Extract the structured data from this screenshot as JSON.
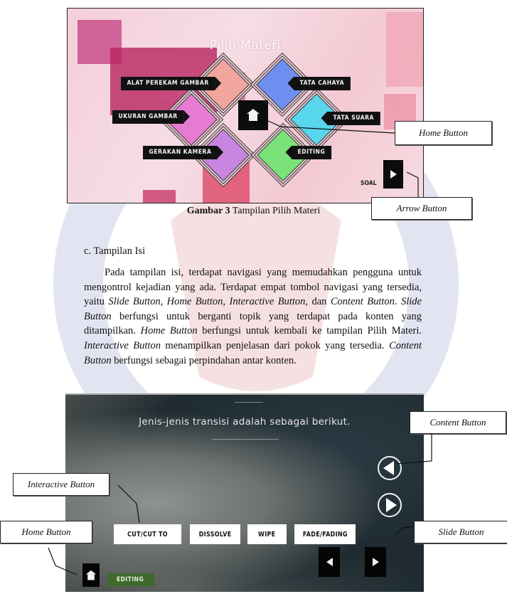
{
  "figure1": {
    "screen_title": "Pilih Materi",
    "topics": [
      {
        "label": "ALAT PEREKAM GAMBAR",
        "color": "#f2a59c",
        "side": "left"
      },
      {
        "label": "UKURAN GAMBAR",
        "color": "#e77ad2",
        "side": "left"
      },
      {
        "label": "GERAKAN KAMERA",
        "color": "#c785e0",
        "side": "left"
      },
      {
        "label": "TATA CAHAYA",
        "color": "#6f8ff0",
        "side": "right"
      },
      {
        "label": "TATA SUARA",
        "color": "#57d6ec",
        "side": "right"
      },
      {
        "label": "EDITING",
        "color": "#7be27a",
        "side": "right"
      }
    ],
    "home_icon": "house-icon",
    "soal_label": "SOAL",
    "arrow_icon": "play-right-icon",
    "callouts": {
      "home_button": "Home Button",
      "arrow_button": "Arrow Button"
    },
    "caption_bold": "Gambar 3",
    "caption_text": " Tampilan Pilih Materi"
  },
  "section": {
    "heading": "c. Tampilan Isi",
    "paragraph": [
      {
        "t": "Pada tampilan isi, terdapat navigasi yang memudahkan pengguna untuk mengontrol kejadian yang ada. Terdapat empat tombol navigasi yang tersedia, yaitu ",
        "i": false
      },
      {
        "t": "Slide Button",
        "i": true
      },
      {
        "t": ", ",
        "i": false
      },
      {
        "t": "Home Button",
        "i": true
      },
      {
        "t": ", ",
        "i": false
      },
      {
        "t": "Interactive Button",
        "i": true
      },
      {
        "t": ", dan ",
        "i": false
      },
      {
        "t": "Content Button",
        "i": true
      },
      {
        "t": ". ",
        "i": false
      },
      {
        "t": "Slide Button",
        "i": true
      },
      {
        "t": " berfungsi untuk berganti topik yang terdapat pada konten yang ditampilkan. ",
        "i": false
      },
      {
        "t": "Home Button",
        "i": true
      },
      {
        "t": " berfungsi untuk kembali ke tampilan Pilih Materi. ",
        "i": false
      },
      {
        "t": "Interactive Button",
        "i": true
      },
      {
        "t": " menampilkan penjelasan dari pokok yang tersedia. ",
        "i": false
      },
      {
        "t": "Content Button",
        "i": true
      },
      {
        "t": " berfungsi sebagai perpindahan antar konten.",
        "i": false
      }
    ]
  },
  "figure2": {
    "screen_title": "Jenis-jenis transisi adalah sebagai berikut.",
    "content_prev_icon": "circle-arrow-left-icon",
    "content_next_icon": "circle-arrow-right-icon",
    "topic_buttons": [
      "CUT/CUT TO",
      "DISSOLVE",
      "WIPE",
      "FADE/FADING"
    ],
    "slide_prev_icon": "arrow-left-icon",
    "slide_next_icon": "arrow-right-icon",
    "home_icon": "house-icon",
    "editing_badge": "EDITING",
    "callouts": {
      "content_button": "Content Button",
      "interactive_button": "Interactive Button",
      "home_button": "Home Button",
      "slide_button": "Slide Button"
    }
  }
}
